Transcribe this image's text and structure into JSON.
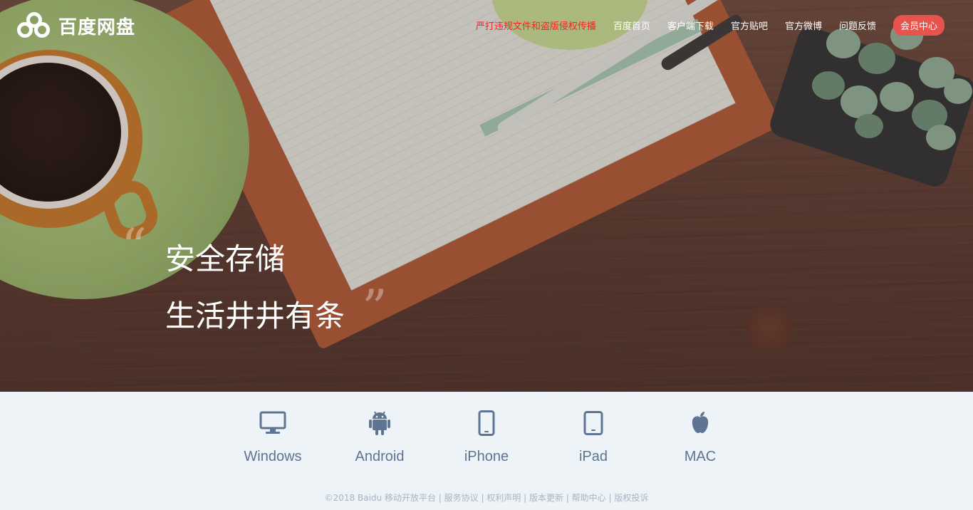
{
  "brand": {
    "name": "百度网盘"
  },
  "nav": {
    "items": [
      {
        "label": "严打违规文件和盗版侵权传播",
        "kind": "warn"
      },
      {
        "label": "百度首页",
        "kind": "normal"
      },
      {
        "label": "客户端下载",
        "kind": "normal"
      },
      {
        "label": "官方贴吧",
        "kind": "normal"
      },
      {
        "label": "官方微博",
        "kind": "normal"
      },
      {
        "label": "问题反馈",
        "kind": "normal"
      },
      {
        "label": "会员中心",
        "kind": "vip"
      }
    ]
  },
  "hero": {
    "line1": "安全存储",
    "line2": "生活井井有条",
    "quote_open": "“",
    "quote_close": "”"
  },
  "platforms": [
    {
      "label": "Windows",
      "icon": "monitor-icon"
    },
    {
      "label": "Android",
      "icon": "android-icon"
    },
    {
      "label": "iPhone",
      "icon": "phone-icon"
    },
    {
      "label": "iPad",
      "icon": "tablet-icon"
    },
    {
      "label": "MAC",
      "icon": "apple-icon"
    }
  ],
  "footer": {
    "text": "©2018 Baidu 移动开放平台 | 服务协议 | 权利声明 | 版本更新 | 帮助中心 | 版权投诉"
  },
  "colors": {
    "warn": "#ff1f1f",
    "vip": "#e7544d",
    "platform": "#5d7493",
    "footer": "#a9b4c2",
    "lower_bg": "#eef3f8"
  }
}
